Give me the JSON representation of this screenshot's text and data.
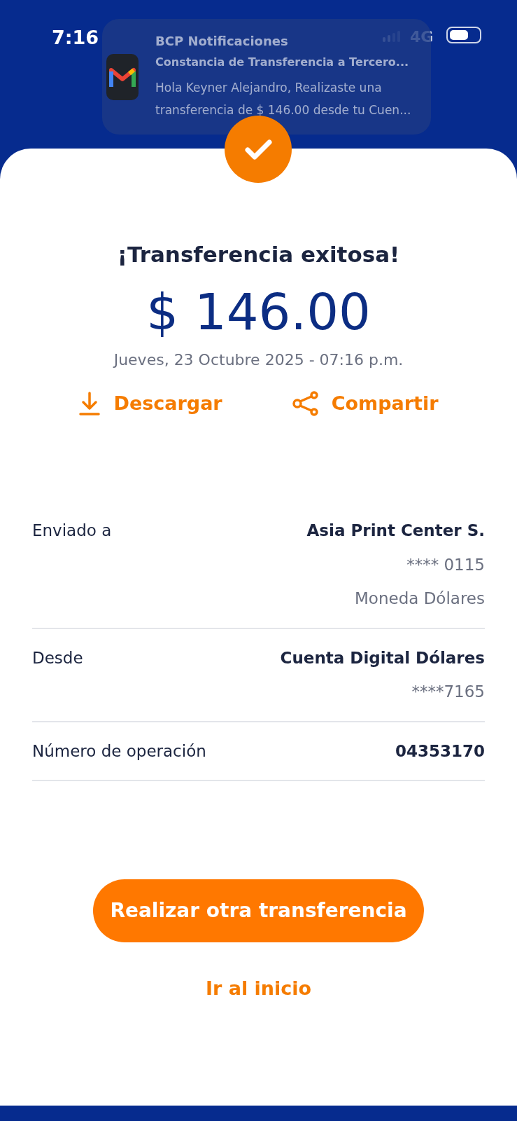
{
  "status_bar": {
    "time": "7:16",
    "network": "4G"
  },
  "notification": {
    "app": "BCP Notificaciones",
    "title": "Constancia de Transferencia a Tercero...",
    "body": "Hola Keyner Alejandro, Realizaste una transferencia de $ 146.00 desde tu Cuen..."
  },
  "result": {
    "title": "¡Transferencia exitosa!",
    "amount": "$ 146.00",
    "date": "Jueves, 23 Octubre 2025 - 07:16 p.m."
  },
  "actions": [
    {
      "kind": "download",
      "label": "Descargar"
    },
    {
      "kind": "share",
      "label": "Compartir"
    }
  ],
  "details": [
    {
      "label": "Enviado a",
      "values": [
        "Asia Print Center S.",
        "**** 0115",
        "Moneda Dólares"
      ]
    },
    {
      "label": "Desde",
      "values": [
        "Cuenta Digital Dólares",
        "****7165"
      ]
    },
    {
      "label": "Número de operación",
      "values": [
        "04353170"
      ]
    }
  ],
  "primary_button": "Realizar otra transferencia",
  "secondary_link": "Ir al inicio"
}
